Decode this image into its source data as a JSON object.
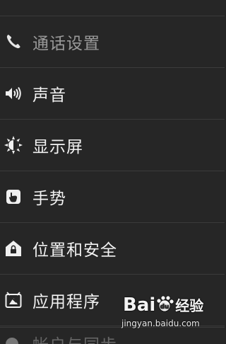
{
  "settings": {
    "items": [
      {
        "label": "通话设置",
        "icon": "phone-icon",
        "enabled": false
      },
      {
        "label": "声音",
        "icon": "speaker-icon",
        "enabled": true
      },
      {
        "label": "显示屏",
        "icon": "brightness-icon",
        "enabled": true
      },
      {
        "label": "手势",
        "icon": "gesture-icon",
        "enabled": true
      },
      {
        "label": "位置和安全",
        "icon": "lock-house-icon",
        "enabled": true
      },
      {
        "label": "应用程序",
        "icon": "app-icon",
        "enabled": true
      }
    ],
    "partial_item_label": "帐户与同步"
  },
  "watermark": {
    "brand_prefix": "Bai",
    "brand_suffix": "du",
    "brand_cn": "经验",
    "url": "jingyan.baidu.com"
  },
  "colors": {
    "background": "#262626",
    "divider": "#3b3b3b",
    "text": "#f2f2f2",
    "text_disabled": "#9a9a9a"
  }
}
